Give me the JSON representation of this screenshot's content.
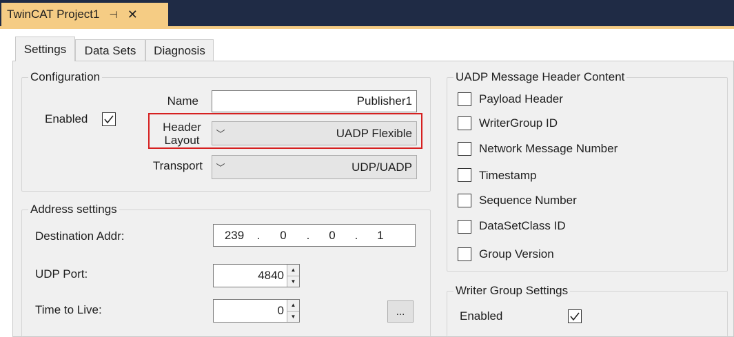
{
  "document_tab": {
    "title": "TwinCAT Project1",
    "pin_icon": "pin-icon",
    "close_icon": "close-icon",
    "pin_glyph": "⊣",
    "close_glyph": "✕"
  },
  "tabs": [
    {
      "label": "Settings",
      "active": true
    },
    {
      "label": "Data Sets",
      "active": false
    },
    {
      "label": "Diagnosis",
      "active": false
    }
  ],
  "configuration": {
    "title": "Configuration",
    "enabled_label": "Enabled",
    "enabled_checked": true,
    "name_label": "Name",
    "name_value": "Publisher1",
    "header_layout_label_line1": "Header",
    "header_layout_label_line2": "Layout",
    "header_layout_value": "UADP Flexible",
    "transport_label": "Transport",
    "transport_value": "UDP/UADP",
    "chevron_glyph": "﹀"
  },
  "address_settings": {
    "title": "Address settings",
    "destination_label": "Destination Addr:",
    "destination_octets": [
      "239",
      "0",
      "0",
      "1"
    ],
    "ip_dot": ".",
    "udp_port_label": "UDP Port:",
    "udp_port_value": "4840",
    "ttl_label": "Time to Live:",
    "ttl_value": "0",
    "browse_button_label": "..."
  },
  "uadp_header": {
    "title": "UADP Message Header Content",
    "items": [
      {
        "label": "Payload Header",
        "checked": false
      },
      {
        "label": "WriterGroup ID",
        "checked": false
      },
      {
        "label": "Network Message Number",
        "checked": false
      },
      {
        "label": "Timestamp",
        "checked": false
      },
      {
        "label": "Sequence Number",
        "checked": false
      },
      {
        "label": "DataSetClass ID",
        "checked": false
      },
      {
        "label": "Group Version",
        "checked": false
      }
    ]
  },
  "writer_group": {
    "title": "Writer Group Settings",
    "enabled_label": "Enabled",
    "enabled_checked": true
  },
  "colors": {
    "title_bar": "#1f2b45",
    "active_doc_tab": "#f5cc84",
    "highlight_border": "#d62020",
    "panel_background": "#f0f0f0"
  }
}
